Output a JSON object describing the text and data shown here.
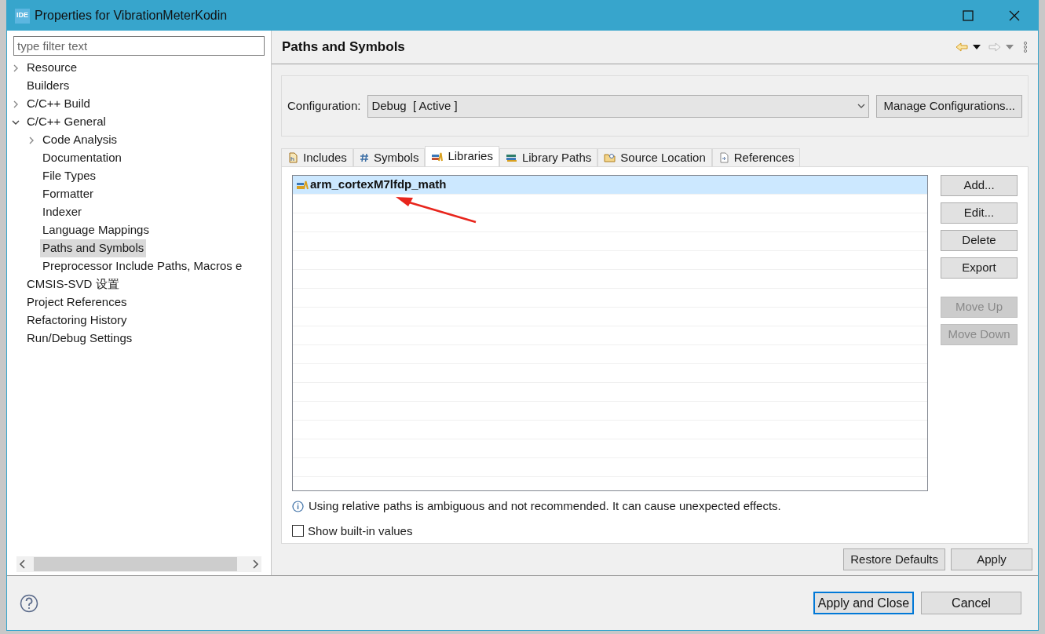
{
  "window": {
    "title": "Properties for VibrationMeterKodin",
    "app_badge": "IDE"
  },
  "filter": {
    "placeholder": "type filter text"
  },
  "tree": [
    {
      "label": "Resource",
      "expanded": false,
      "selected": false
    },
    {
      "label": "Builders",
      "selected": false
    },
    {
      "label": "C/C++ Build",
      "expanded": false,
      "selected": false
    },
    {
      "label": "C/C++ General",
      "expanded": true,
      "selected": false,
      "children": [
        {
          "label": "Code Analysis",
          "expanded": false,
          "selected": false
        },
        {
          "label": "Documentation",
          "selected": false
        },
        {
          "label": "File Types",
          "selected": false
        },
        {
          "label": "Formatter",
          "selected": false
        },
        {
          "label": "Indexer",
          "selected": false
        },
        {
          "label": "Language Mappings",
          "selected": false
        },
        {
          "label": "Paths and Symbols",
          "selected": true
        },
        {
          "label": "Preprocessor Include Paths, Macros e",
          "selected": false
        }
      ]
    },
    {
      "label": "CMSIS-SVD 设置",
      "selected": false
    },
    {
      "label": "Project References",
      "selected": false
    },
    {
      "label": "Refactoring History",
      "selected": false
    },
    {
      "label": "Run/Debug Settings",
      "selected": false
    }
  ],
  "page": {
    "title": "Paths and Symbols"
  },
  "configuration": {
    "label": "Configuration:",
    "value": "Debug  [ Active ]",
    "button": "Manage Configurations..."
  },
  "tabs": [
    {
      "label": "Includes",
      "selected": false,
      "kind": "includes"
    },
    {
      "label": "Symbols",
      "selected": false,
      "kind": "symbols"
    },
    {
      "label": "Libraries",
      "selected": true,
      "kind": "libraries"
    },
    {
      "label": "Library Paths",
      "selected": false,
      "kind": "librarypaths"
    },
    {
      "label": "Source Location",
      "selected": false,
      "kind": "source"
    },
    {
      "label": "References",
      "selected": false,
      "kind": "references"
    }
  ],
  "libraries": [
    {
      "name": "arm_cortexM7lfdp_math",
      "selected": true
    }
  ],
  "side_buttons": [
    {
      "label": "Add...",
      "disabled": false
    },
    {
      "label": "Edit...",
      "disabled": false
    },
    {
      "label": "Delete",
      "disabled": false
    },
    {
      "label": "Export",
      "disabled": false
    },
    {
      "label": "Move Up",
      "disabled": true
    },
    {
      "label": "Move Down",
      "disabled": true
    }
  ],
  "info": "Using relative paths is ambiguous and not recommended. It can cause unexpected effects.",
  "show_builtin": {
    "label": "Show built-in values",
    "checked": false
  },
  "page_buttons": [
    "Restore Defaults",
    "Apply"
  ],
  "dialog_buttons": [
    {
      "label": "Apply and Close",
      "default": true
    },
    {
      "label": "Cancel",
      "default": false
    }
  ]
}
